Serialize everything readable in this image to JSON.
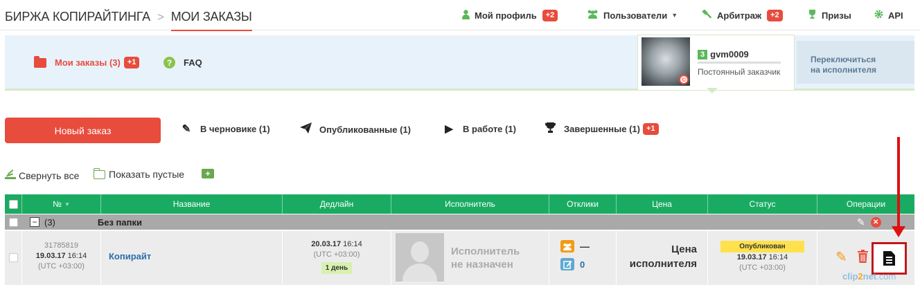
{
  "breadcrumb": {
    "root": "БИРЖА КОПИРАЙТИНГА",
    "separator": ">",
    "current": "МОИ ЗАКАЗЫ"
  },
  "topmenu": {
    "profile": {
      "label": "Мой профиль",
      "badge": "+2",
      "icon": "user-icon"
    },
    "users": {
      "label": "Пользователи",
      "icon": "users-icon"
    },
    "arbitrage": {
      "label": "Арбитраж",
      "badge": "+2",
      "icon": "gavel-icon"
    },
    "prizes": {
      "label": "Призы",
      "icon": "trophy-icon"
    },
    "api": {
      "label": "API",
      "icon": "gear-icon"
    }
  },
  "panel": {
    "my_orders": {
      "label": "Мои заказы (3)",
      "badge": "+1"
    },
    "faq": {
      "label": "FAQ",
      "icon_glyph": "?"
    },
    "profile": {
      "level": "3",
      "username": "gvm0009",
      "role": "Постоянный заказчик",
      "avatar_badge": "©"
    },
    "switch_line1": "Переключиться",
    "switch_line2": "на исполнителя"
  },
  "new_order_button": "Новый заказ",
  "tabs": [
    {
      "label": "В черновике (1)",
      "icon": "pencil-icon"
    },
    {
      "label": "Опубликованные (1)",
      "icon": "paper-plane-icon"
    },
    {
      "label": "В работе (1)",
      "icon": "play-icon"
    },
    {
      "label": "Завершенные (1)",
      "icon": "trophy-icon",
      "badge": "+1"
    }
  ],
  "tools": {
    "collapse_all": "Свернуть все",
    "show_empty": "Показать пустые",
    "add_folder_glyph": "+"
  },
  "table": {
    "columns": [
      "№",
      "Название",
      "Дедлайн",
      "Исполнитель",
      "Отклики",
      "Цена",
      "Статус",
      "Операции"
    ],
    "group": {
      "count": "(3)",
      "name": "Без папки"
    },
    "row": {
      "id": "31785819",
      "created_date": "19.03.17",
      "created_time": "16:14",
      "created_tz": "(UTC +03:00)",
      "title": "Копирайт",
      "deadline_date": "20.03.17",
      "deadline_time": "16:14",
      "deadline_tz": "(UTC +03:00)",
      "deadline_left": "1 день",
      "executor_line1": "Исполнитель",
      "executor_line2": "не назначен",
      "responses_count": "—",
      "comments_count": "0",
      "price_line1": "Цена",
      "price_line2": "исполнителя",
      "status": "Опубликован",
      "status_date": "19.03.17",
      "status_time": "16:14",
      "status_tz": "(UTC +03:00)"
    }
  },
  "watermark": {
    "part1": "clip",
    "part2": "2",
    "part3": "net",
    "part4": ".com"
  },
  "colors": {
    "accent_red": "#e74c3c",
    "table_green": "#1aab63",
    "panel_blue": "#e8f2fb",
    "status_yellow": "#ffe14d",
    "annotation_red": "#c0171b"
  }
}
